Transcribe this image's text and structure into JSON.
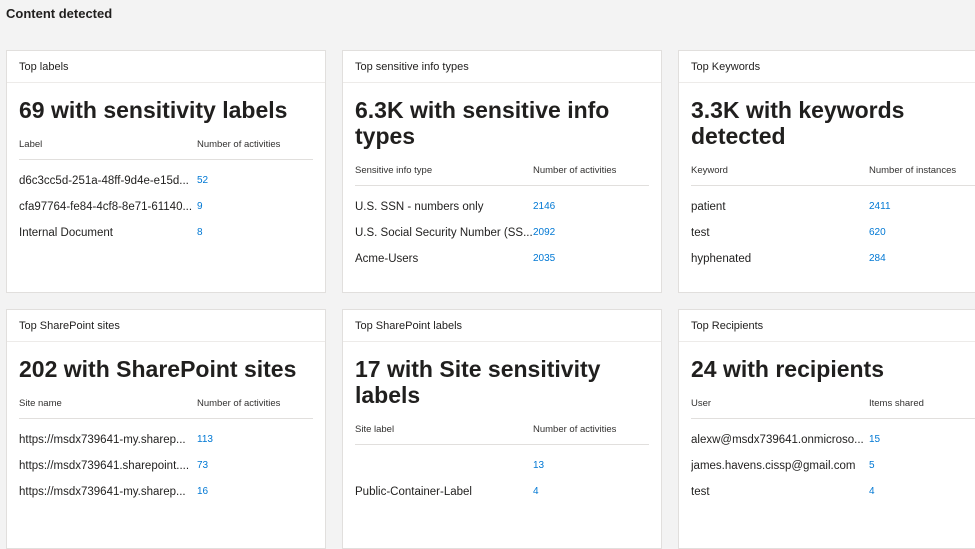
{
  "page": {
    "title": "Content detected"
  },
  "cards": [
    {
      "header": "Top labels",
      "headline": "69 with sensitivity labels",
      "col_name": "Label",
      "col_val": "Number of activities",
      "rows": [
        {
          "name": "d6c3cc5d-251a-48ff-9d4e-e15d...",
          "value": "52"
        },
        {
          "name": "cfa97764-fe84-4cf8-8e71-61140...",
          "value": "9"
        },
        {
          "name": "Internal Document",
          "value": "8"
        }
      ]
    },
    {
      "header": "Top sensitive info types",
      "headline": "6.3K with sensitive info types",
      "col_name": "Sensitive info type",
      "col_val": "Number of activities",
      "rows": [
        {
          "name": "U.S. SSN - numbers only",
          "value": "2146"
        },
        {
          "name": "U.S. Social Security Number (SS...",
          "value": "2092"
        },
        {
          "name": "Acme-Users",
          "value": "2035"
        }
      ]
    },
    {
      "header": "Top Keywords",
      "headline": "3.3K with keywords detected",
      "col_name": "Keyword",
      "col_val": "Number of instances",
      "rows": [
        {
          "name": "patient",
          "value": "2411"
        },
        {
          "name": "test",
          "value": "620"
        },
        {
          "name": "hyphenated",
          "value": "284"
        }
      ]
    },
    {
      "header": "Top SharePoint sites",
      "headline": "202 with SharePoint sites",
      "col_name": "Site name",
      "col_val": "Number of activities",
      "rows": [
        {
          "name": "https://msdx739641-my.sharep...",
          "value": "113"
        },
        {
          "name": "https://msdx739641.sharepoint....",
          "value": "73"
        },
        {
          "name": "https://msdx739641-my.sharep...",
          "value": "16"
        }
      ]
    },
    {
      "header": "Top SharePoint labels",
      "headline": "17 with Site sensitivity labels",
      "col_name": "Site label",
      "col_val": "Number of activities",
      "rows": [
        {
          "name": "",
          "value": "13"
        },
        {
          "name": "Public-Container-Label",
          "value": "4"
        }
      ]
    },
    {
      "header": "Top Recipients",
      "headline": "24 with recipients",
      "col_name": "User",
      "col_val": "Items shared",
      "rows": [
        {
          "name": "alexw@msdx739641.onmicroso...",
          "value": "15"
        },
        {
          "name": "james.havens.cissp@gmail.com",
          "value": "5"
        },
        {
          "name": "test",
          "value": "4"
        }
      ]
    }
  ],
  "colors": {
    "background": "#f3f3f3",
    "card": "#ffffff",
    "link": "#0078d4",
    "text": "#201f1e"
  }
}
